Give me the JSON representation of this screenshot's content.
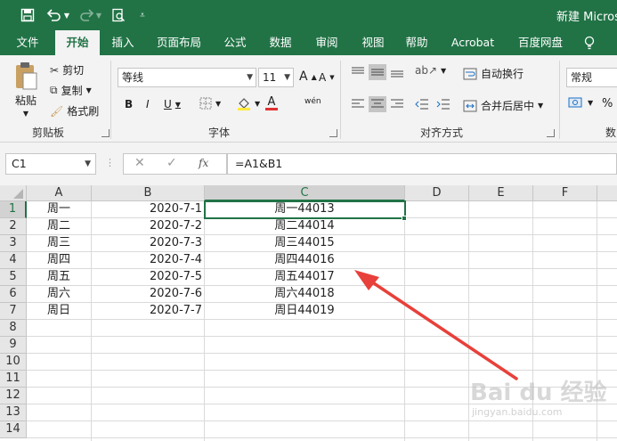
{
  "title_bar": {
    "document_title": "新建 Micros",
    "quick_access": [
      "save-icon",
      "undo-icon",
      "redo-icon",
      "print-preview-icon",
      "customize-icon"
    ]
  },
  "ribbon_tabs": [
    "文件",
    "开始",
    "插入",
    "页面布局",
    "公式",
    "数据",
    "审阅",
    "视图",
    "帮助",
    "Acrobat",
    "百度网盘"
  ],
  "active_tab": "开始",
  "clipboard": {
    "paste": "粘贴",
    "cut": "剪切",
    "copy": "复制",
    "format_painter": "格式刷",
    "group_label": "剪贴板"
  },
  "font": {
    "name": "等线",
    "size": "11",
    "bold": "B",
    "italic": "I",
    "underline": "U",
    "grow": "A",
    "shrink": "A",
    "font_color_letter": "A",
    "phonetic": "wén",
    "group_label": "字体"
  },
  "alignment": {
    "wrap_text": "自动换行",
    "merge_center": "合并后居中",
    "group_label": "对齐方式"
  },
  "number": {
    "format": "常规",
    "percent": "%",
    "group_label": "数"
  },
  "formula_bar": {
    "name_box": "C1",
    "fx": "fx",
    "formula": "=A1&B1"
  },
  "columns": [
    "A",
    "B",
    "C",
    "D",
    "E",
    "F"
  ],
  "rows": [
    "1",
    "2",
    "3",
    "4",
    "5",
    "6",
    "7",
    "8",
    "9",
    "10",
    "11",
    "12",
    "13",
    "14"
  ],
  "cells": [
    [
      "周一",
      "2020-7-1",
      "周一44013"
    ],
    [
      "周二",
      "2020-7-2",
      "周二44014"
    ],
    [
      "周三",
      "2020-7-3",
      "周三44015"
    ],
    [
      "周四",
      "2020-7-4",
      "周四44016"
    ],
    [
      "周五",
      "2020-7-5",
      "周五44017"
    ],
    [
      "周六",
      "2020-7-6",
      "周六44018"
    ],
    [
      "周日",
      "2020-7-7",
      "周日44019"
    ]
  ],
  "watermark": {
    "text": "Bai du 经验",
    "sub": "jingyan.baidu.com"
  },
  "colors": {
    "excel_green": "#217346",
    "annotation_arrow": "#e8403a"
  }
}
